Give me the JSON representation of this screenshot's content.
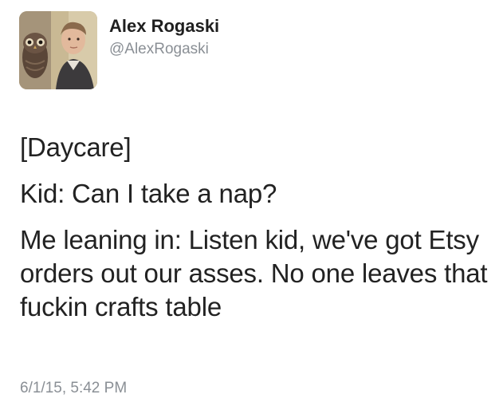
{
  "user": {
    "display_name": "Alex Rogaski",
    "handle": "@AlexRogaski",
    "avatar_icon": "profile-photo-with-owl"
  },
  "tweet": {
    "paragraphs": [
      "[Daycare]",
      "Kid: Can I take a nap?",
      "Me leaning in: Listen kid, we've got Etsy orders out our asses. No one leaves that fuckin crafts table"
    ],
    "timestamp": "6/1/15, 5:42 PM"
  },
  "colors": {
    "text": "#222222",
    "secondary": "#8a8f95",
    "background": "#ffffff"
  }
}
